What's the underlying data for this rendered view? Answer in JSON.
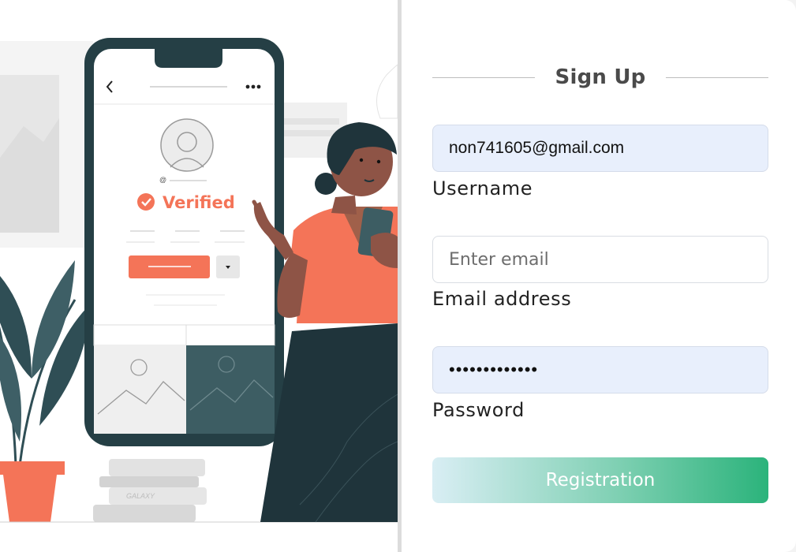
{
  "form": {
    "title": "Sign Up",
    "username": {
      "value": "non741605@gmail.com",
      "label": "Username"
    },
    "email": {
      "value": "",
      "placeholder": "Enter email",
      "label": "Email address"
    },
    "password": {
      "value": "•••••••••••••",
      "label": "Password"
    },
    "submit_label": "Registration"
  },
  "illustration": {
    "verified_text": "Verified",
    "at_sign": "@",
    "book_text": "GALAXY"
  },
  "colors": {
    "accent_orange": "#f47458",
    "dark_teal": "#2f4e55",
    "button_start": "#d9eef4",
    "button_end": "#2bb37b",
    "autofill_bg": "#e8effc"
  }
}
